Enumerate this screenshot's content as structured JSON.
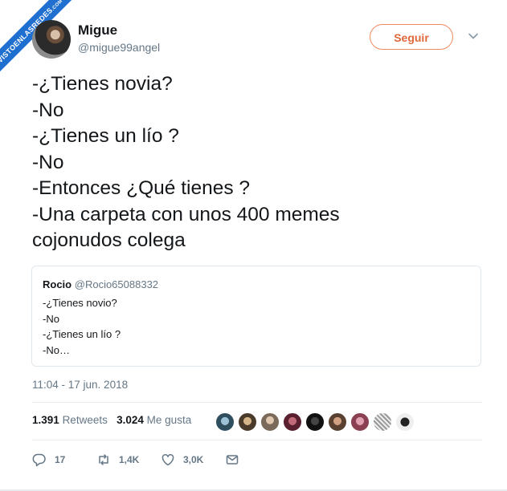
{
  "watermark": {
    "text": "VISTOENLASREDES",
    "suffix": ".COM"
  },
  "author": {
    "name": "Migue",
    "handle": "@migue99angel"
  },
  "follow_label": "Seguir",
  "tweet_lines": [
    "-¿Tienes novia?",
    "-No",
    "-¿Tienes un lío ?",
    "-No",
    "-Entonces ¿Qué tienes ?",
    "-Una carpeta con unos 400 memes",
    "cojonudos colega"
  ],
  "quoted": {
    "name": "Rocio",
    "handle": "@Rocio65088332",
    "lines": [
      "-¿Tienes novio?",
      "-No",
      "-¿Tienes un lío ?",
      "-No…"
    ]
  },
  "timestamp": "11:04 - 17 jun. 2018",
  "stats": {
    "retweets_count": "1.391",
    "retweets_label": "Retweets",
    "likes_count": "3.024",
    "likes_label": "Me gusta"
  },
  "likers_count_shown": 9,
  "actions": {
    "replies": "17",
    "retweets": "1,4K",
    "likes": "3,0K"
  },
  "colors": {
    "accent": "#e0683a",
    "muted": "#657786",
    "text": "#14171a",
    "border": "#e1e8ed"
  },
  "icons": [
    "chevron-down-icon",
    "reply-icon",
    "retweet-icon",
    "heart-icon",
    "mail-icon"
  ]
}
